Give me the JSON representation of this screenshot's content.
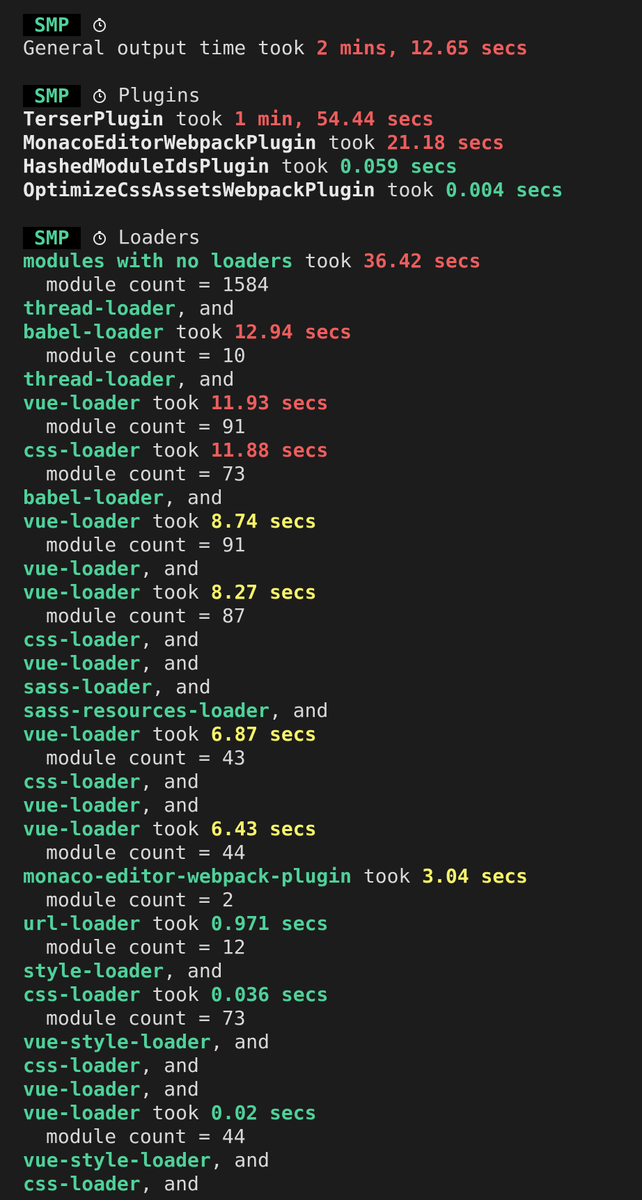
{
  "sections": {
    "general": {
      "badge": "SMP",
      "icon": "stopwatch-icon",
      "label": "General output time",
      "took": "took",
      "time": "2 mins, 12.65 secs"
    },
    "plugins": {
      "badge": "SMP",
      "icon": "stopwatch-icon",
      "title": "Plugins",
      "items": [
        {
          "name": "TerserPlugin",
          "took": "took",
          "time": "1 min, 54.44 secs"
        },
        {
          "name": "MonacoEditorWebpackPlugin",
          "took": "took",
          "time": "21.18 secs"
        },
        {
          "name": "HashedModuleIdsPlugin",
          "took": "took",
          "time": "0.059 secs"
        },
        {
          "name": "OptimizeCssAssetsWebpackPlugin",
          "took": "took",
          "time": "0.004 secs"
        }
      ]
    },
    "loaders": {
      "badge": "SMP",
      "icon": "stopwatch-icon",
      "title": "Loaders",
      "sep": ", and",
      "took": "took",
      "lines": [
        {
          "kind": "took",
          "name": "modules with no loaders",
          "time": "36.42 secs",
          "color": "red"
        },
        {
          "kind": "count",
          "text": "module count = 1584"
        },
        {
          "kind": "and",
          "name": "thread-loader"
        },
        {
          "kind": "took",
          "name": "babel-loader",
          "time": "12.94 secs",
          "color": "red"
        },
        {
          "kind": "count",
          "text": "module count = 10"
        },
        {
          "kind": "and",
          "name": "thread-loader"
        },
        {
          "kind": "took",
          "name": "vue-loader",
          "time": "11.93 secs",
          "color": "red"
        },
        {
          "kind": "count",
          "text": "module count = 91"
        },
        {
          "kind": "took",
          "name": "css-loader",
          "time": "11.88 secs",
          "color": "red"
        },
        {
          "kind": "count",
          "text": "module count = 73"
        },
        {
          "kind": "and",
          "name": "babel-loader"
        },
        {
          "kind": "took",
          "name": "vue-loader",
          "time": "8.74 secs",
          "color": "yellow"
        },
        {
          "kind": "count",
          "text": "module count = 91"
        },
        {
          "kind": "and",
          "name": "vue-loader"
        },
        {
          "kind": "took",
          "name": "vue-loader",
          "time": "8.27 secs",
          "color": "yellow"
        },
        {
          "kind": "count",
          "text": "module count = 87"
        },
        {
          "kind": "and",
          "name": "css-loader"
        },
        {
          "kind": "and",
          "name": "vue-loader"
        },
        {
          "kind": "and",
          "name": "sass-loader"
        },
        {
          "kind": "and",
          "name": "sass-resources-loader"
        },
        {
          "kind": "took",
          "name": "vue-loader",
          "time": "6.87 secs",
          "color": "yellow"
        },
        {
          "kind": "count",
          "text": "module count = 43"
        },
        {
          "kind": "and",
          "name": "css-loader"
        },
        {
          "kind": "and",
          "name": "vue-loader"
        },
        {
          "kind": "took",
          "name": "vue-loader",
          "time": "6.43 secs",
          "color": "yellow"
        },
        {
          "kind": "count",
          "text": "module count = 44"
        },
        {
          "kind": "took",
          "name": "monaco-editor-webpack-plugin",
          "time": "3.04 secs",
          "color": "yellow"
        },
        {
          "kind": "count",
          "text": "module count = 2"
        },
        {
          "kind": "took",
          "name": "url-loader",
          "time": "0.971 secs",
          "color": "green"
        },
        {
          "kind": "count",
          "text": "module count = 12"
        },
        {
          "kind": "and",
          "name": "style-loader"
        },
        {
          "kind": "took",
          "name": "css-loader",
          "time": "0.036 secs",
          "color": "green"
        },
        {
          "kind": "count",
          "text": "module count = 73"
        },
        {
          "kind": "and",
          "name": "vue-style-loader"
        },
        {
          "kind": "and",
          "name": "css-loader"
        },
        {
          "kind": "and",
          "name": "vue-loader"
        },
        {
          "kind": "took",
          "name": "vue-loader",
          "time": "0.02 secs",
          "color": "green"
        },
        {
          "kind": "count",
          "text": "module count = 44"
        },
        {
          "kind": "and",
          "name": "vue-style-loader"
        },
        {
          "kind": "and",
          "name": "css-loader"
        }
      ]
    }
  },
  "colors": {
    "background": "#1c1c1c",
    "green": "#4fd19a",
    "red": "#ee5d5d",
    "yellow": "#f7f46a",
    "text": "#d9d9d9"
  }
}
